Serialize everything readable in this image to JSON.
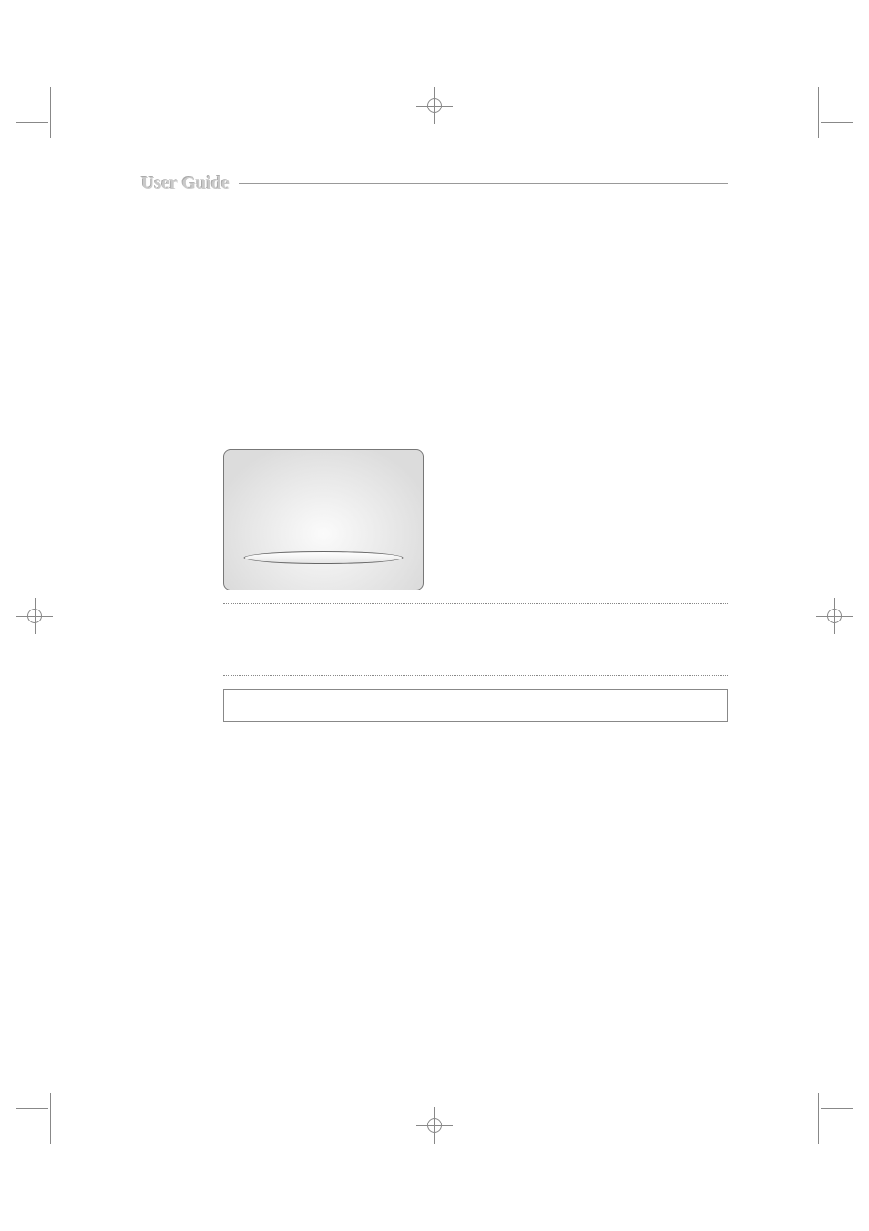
{
  "header": {
    "label": "User Guide"
  }
}
